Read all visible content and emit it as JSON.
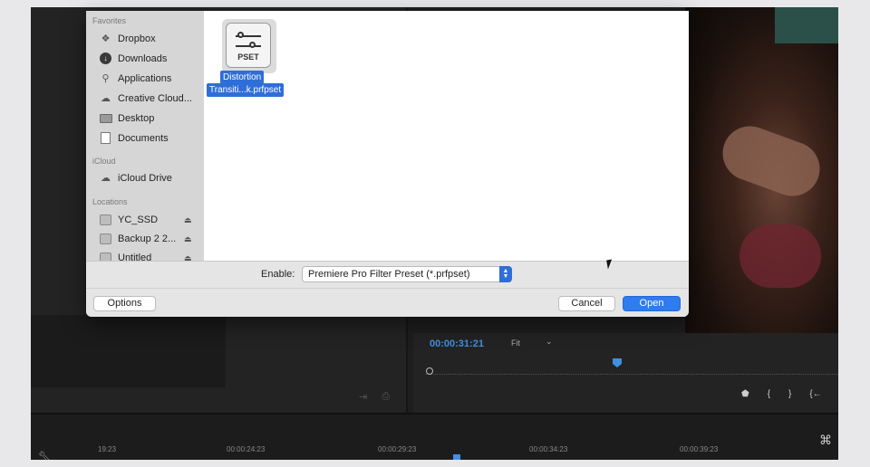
{
  "dialog": {
    "sidebar": {
      "sections": [
        {
          "heading": "Favorites",
          "items": [
            {
              "label": "Dropbox",
              "icon": "dropbox-icon"
            },
            {
              "label": "Downloads",
              "icon": "downloads-icon"
            },
            {
              "label": "Applications",
              "icon": "applications-icon"
            },
            {
              "label": "Creative Cloud...",
              "icon": "creative-cloud-icon"
            },
            {
              "label": "Desktop",
              "icon": "desktop-icon"
            },
            {
              "label": "Documents",
              "icon": "documents-icon"
            }
          ]
        },
        {
          "heading": "iCloud",
          "items": [
            {
              "label": "iCloud Drive",
              "icon": "icloud-icon"
            }
          ]
        },
        {
          "heading": "Locations",
          "items": [
            {
              "label": "YC_SSD",
              "icon": "drive-icon",
              "eject": "⏏"
            },
            {
              "label": "Backup 2 2...",
              "icon": "drive-icon",
              "eject": "⏏"
            },
            {
              "label": "Untitled",
              "icon": "drive-icon",
              "eject": "⏏"
            }
          ]
        }
      ]
    },
    "file": {
      "badge": "PSET",
      "name_line1": "Distortion",
      "name_line2": "Transiti...k.prfpset"
    },
    "enable_label": "Enable:",
    "enable_value": "Premiere Pro Filter Preset (*.prfpset)",
    "options_label": "Options",
    "cancel_label": "Cancel",
    "open_label": "Open"
  },
  "program_monitor": {
    "timecode": "00:00:31:21",
    "zoom": "Fit"
  },
  "timeline": {
    "ruler_labels": [
      "19:23",
      "00:00:24:23",
      "00:00:29:23",
      "00:00:34:23",
      "00:00:39:23"
    ]
  },
  "colors": {
    "accent": "#2f7bf0",
    "selection": "#2f6ed8",
    "timecode": "#3f8fe2"
  }
}
